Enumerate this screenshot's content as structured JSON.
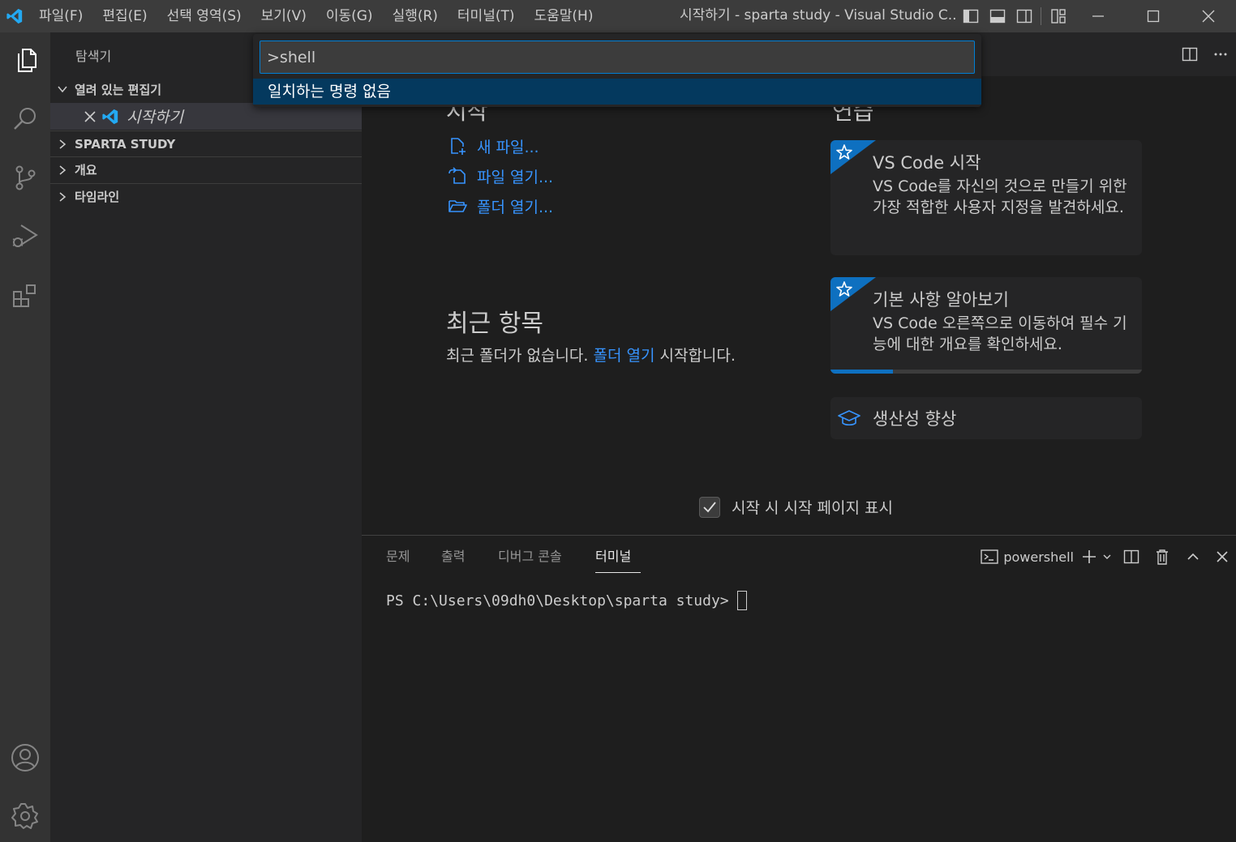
{
  "titlebar": {
    "menu": [
      "파일(F)",
      "편집(E)",
      "선택 영역(S)",
      "보기(V)",
      "이동(G)",
      "실행(R)",
      "터미널(T)",
      "도움말(H)"
    ],
    "title": "시작하기 - sparta study - Visual Studio C..."
  },
  "sidebar": {
    "title": "탐색기",
    "open_editors": "열려 있는 편집기",
    "open_file": "시작하기",
    "sections": [
      "SPARTA STUDY",
      "개요",
      "타임라인"
    ]
  },
  "palette": {
    "input_value": ">shell",
    "result": "일치하는 명령 없음"
  },
  "welcome": {
    "start_heading_partial": "시작",
    "learn_heading_partial": "연습",
    "start_links": [
      "새 파일...",
      "파일 열기...",
      "폴더 열기..."
    ],
    "recent_title": "최근 항목",
    "recent_text_before": "최근 폴더가 없습니다. ",
    "recent_link": "폴더 열기",
    "recent_text_after": " 시작합니다.",
    "cards": [
      {
        "title": "VS Code 시작",
        "desc": "VS Code를 자신의 것으로 만들기 위한 가장 적합한 사용자 지정을 발견하세요."
      },
      {
        "title": "기본 사항 알아보기",
        "desc": "VS Code 오른쪽으로 이동하여 필수 기능에 대한 개요를 확인하세요.",
        "progress": 0.2
      },
      {
        "title": "생산성 향상"
      }
    ],
    "show_on_startup": "시작 시 시작 페이지 표시"
  },
  "panel": {
    "tabs": [
      "문제",
      "출력",
      "디버그 콘솔",
      "터미널"
    ],
    "active_tab": "터미널",
    "shell": "powershell",
    "terminal_prompt": "PS C:\\Users\\09dh0\\Desktop\\sparta study>"
  },
  "colors": {
    "accent": "#0e70c0",
    "link": "#3794ff",
    "vscode_blue": "#23a9f2"
  }
}
